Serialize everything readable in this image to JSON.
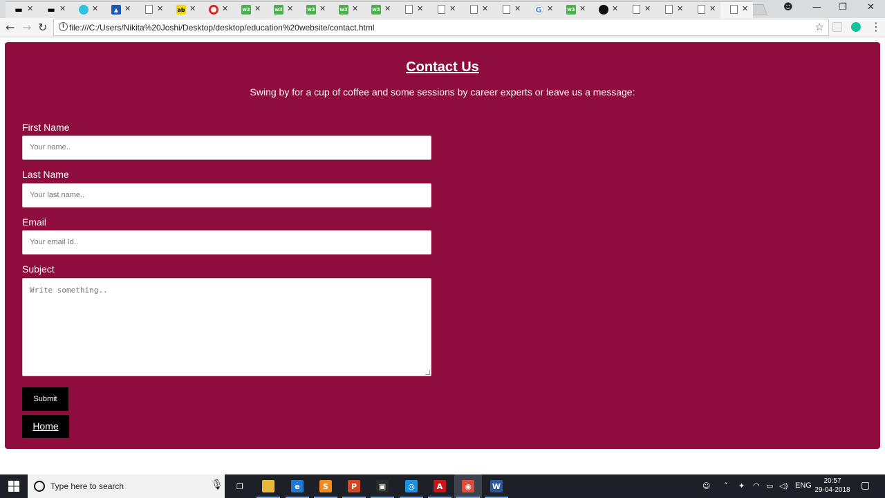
{
  "browser": {
    "tabs": [
      {
        "icon": "graduation-cap-icon",
        "style": "cap",
        "glyph": "▬"
      },
      {
        "icon": "graduation-cap-icon",
        "style": "cap",
        "glyph": "▬",
        "active": true
      },
      {
        "icon": "cyan-globe-icon",
        "style": "cyan",
        "glyph": ""
      },
      {
        "icon": "blue-site-icon",
        "style": "blue",
        "glyph": "▲"
      },
      {
        "icon": "page-icon",
        "style": "doc",
        "glyph": ""
      },
      {
        "icon": "yellow-site-icon",
        "style": "yellow",
        "glyph": "ab"
      },
      {
        "icon": "opera-icon",
        "style": "opera",
        "glyph": ""
      },
      {
        "icon": "w3schools-icon",
        "style": "w3",
        "glyph": "w3"
      },
      {
        "icon": "w3schools-icon",
        "style": "w3",
        "glyph": "w3"
      },
      {
        "icon": "w3schools-icon",
        "style": "w3",
        "glyph": "w3"
      },
      {
        "icon": "w3schools-icon",
        "style": "w3",
        "glyph": "w3"
      },
      {
        "icon": "w3schools-icon",
        "style": "w3",
        "glyph": "w3"
      },
      {
        "icon": "page-icon",
        "style": "doc",
        "glyph": ""
      },
      {
        "icon": "page-icon",
        "style": "doc",
        "glyph": ""
      },
      {
        "icon": "page-icon",
        "style": "doc",
        "glyph": ""
      },
      {
        "icon": "page-icon",
        "style": "doc",
        "glyph": ""
      },
      {
        "icon": "google-icon",
        "style": "g",
        "glyph": "G"
      },
      {
        "icon": "w3schools-icon",
        "style": "w3",
        "glyph": "w3"
      },
      {
        "icon": "github-icon",
        "style": "gh",
        "glyph": ""
      },
      {
        "icon": "page-icon",
        "style": "doc",
        "glyph": ""
      },
      {
        "icon": "page-icon",
        "style": "doc",
        "glyph": ""
      },
      {
        "icon": "page-icon",
        "style": "doc",
        "glyph": ""
      },
      {
        "icon": "page-icon",
        "style": "doc",
        "glyph": "",
        "active": true
      }
    ],
    "url": "file:///C:/Users/Nikita%20Joshi/Desktop/desktop/education%20website/contact.html"
  },
  "page": {
    "title": "Contact Us",
    "subtitle": "Swing by for a cup of coffee and some sessions by career experts or leave us a message:",
    "first_name_label": "First Name",
    "first_name_placeholder": "Your name..",
    "last_name_label": "Last Name",
    "last_name_placeholder": "Your last name..",
    "email_label": "Email",
    "email_placeholder": "Your email Id..",
    "subject_label": "Subject",
    "subject_placeholder": "Write something..",
    "submit_label": "Submit",
    "home_label": "Home",
    "background_color": "#8f0c3e"
  },
  "taskbar": {
    "search_placeholder": "Type here to search",
    "apps": [
      {
        "name": "task-view-icon",
        "glyph": "❐",
        "color": "transparent"
      },
      {
        "name": "file-explorer-icon",
        "glyph": "",
        "color": "#e8b83a"
      },
      {
        "name": "edge-icon",
        "glyph": "e",
        "color": "#1e78d4"
      },
      {
        "name": "sublime-text-icon",
        "glyph": "S",
        "color": "#f28a1d"
      },
      {
        "name": "powerpoint-icon",
        "glyph": "P",
        "color": "#d24726"
      },
      {
        "name": "store-icon",
        "glyph": "▣",
        "color": "#2b2b2b"
      },
      {
        "name": "safari-icon",
        "glyph": "◎",
        "color": "#1b8fe0"
      },
      {
        "name": "acrobat-icon",
        "glyph": "A",
        "color": "#c8161d"
      },
      {
        "name": "chrome-icon",
        "glyph": "◉",
        "color": "#dd4b39"
      },
      {
        "name": "word-icon",
        "glyph": "W",
        "color": "#2b579a"
      }
    ],
    "language": "ENG",
    "time": "20:57",
    "date": "29-04-2018"
  }
}
